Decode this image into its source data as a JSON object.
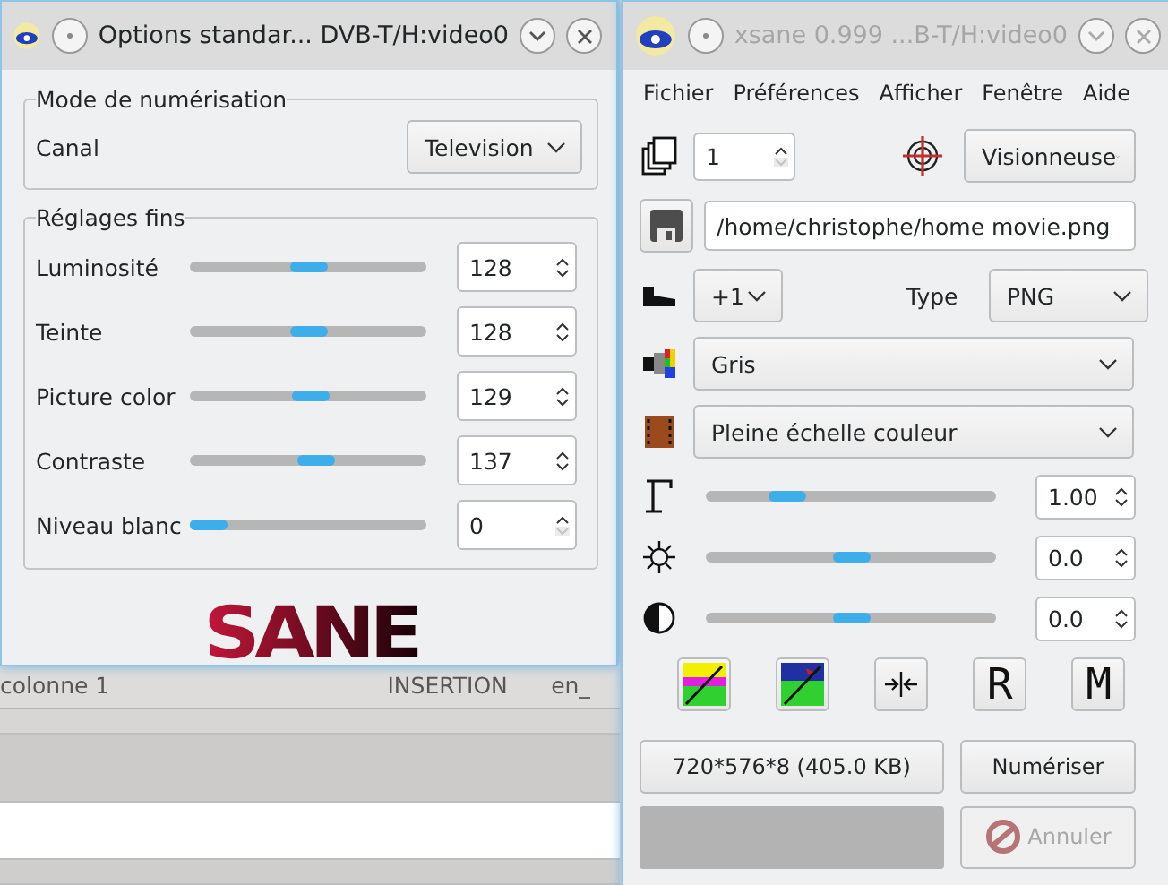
{
  "background_app": {
    "status": [
      {
        "text": "colonne 1"
      },
      {
        "text": "INSERTION"
      },
      {
        "text": "en_"
      }
    ]
  },
  "options_window": {
    "title": "Options standar... DVB-T/H:video0",
    "active": true,
    "scan_mode": {
      "legend": "Mode de numérisation",
      "label": "Canal",
      "value": "Television"
    },
    "fine": {
      "legend": "Réglages fins",
      "sliders": [
        {
          "label": "Luminosité",
          "level": 0.5,
          "value": "128",
          "down_disabled": false
        },
        {
          "label": "Teinte",
          "level": 0.5,
          "value": "128",
          "down_disabled": false
        },
        {
          "label": "Picture color",
          "level": 0.51,
          "value": "129",
          "down_disabled": false
        },
        {
          "label": "Contraste",
          "level": 0.54,
          "value": "137",
          "down_disabled": false
        },
        {
          "label": "Niveau blanc",
          "level": 0,
          "value": "0",
          "down_disabled": true
        }
      ]
    },
    "logo": "SANE"
  },
  "xsane_window": {
    "title": "xsane 0.999 ...B-T/H:video0",
    "active": false,
    "menu": [
      "Fichier",
      "Préférences",
      "Afficher",
      "Fenêtre",
      "Aide"
    ],
    "copies": {
      "value": "1",
      "down_disabled": true
    },
    "viewer": "Visionneuse",
    "filename": "/home/christophe/home movie.png",
    "step": "+1",
    "type_label": "Type",
    "type_value": "PNG",
    "color_mode": "Gris",
    "source": "Pleine échelle couleur",
    "enhancements": [
      {
        "kind": "gamma",
        "level": 0.25,
        "value": "1.00"
      },
      {
        "kind": "brightness",
        "level": 0.5,
        "value": "0.0"
      },
      {
        "kind": "contrast",
        "level": 0.5,
        "value": "0.0"
      }
    ],
    "tool_buttons": [
      {
        "kind": "auto"
      },
      {
        "kind": "picture"
      },
      {
        "kind": "compress"
      },
      {
        "kind": "letter",
        "label": "R"
      },
      {
        "kind": "letter",
        "label": "M"
      }
    ],
    "size": "720*576*8 (405.0 KB)",
    "scan_button": "Numériser",
    "progress": {
      "level": 0
    },
    "cancel": {
      "label": "Annuler",
      "disabled": true
    }
  }
}
